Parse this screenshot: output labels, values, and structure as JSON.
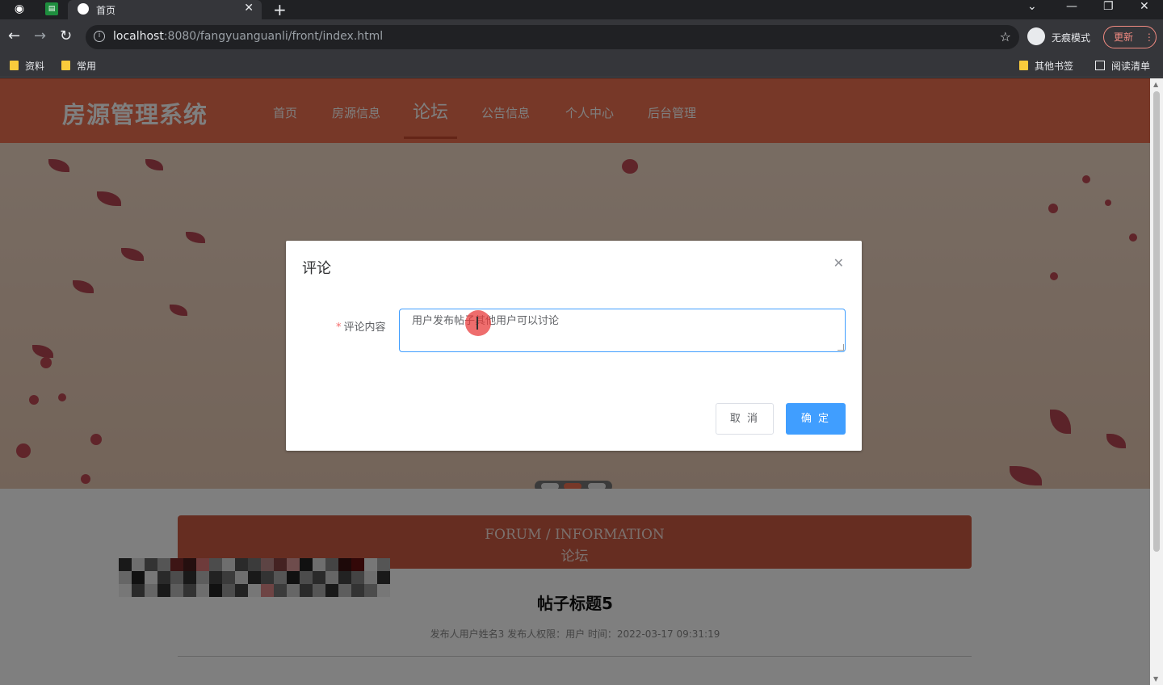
{
  "browser": {
    "tab_title": "首页",
    "url_host": "localhost",
    "url_rest": ":8080/fangyuanguanli/front/index.html",
    "incognito_label": "无痕模式",
    "update_label": "更新",
    "bookmarks": [
      "资料",
      "常用"
    ],
    "bookmarks_right": [
      "其他书签",
      "阅读清单"
    ]
  },
  "site": {
    "logo": "房源管理系统",
    "menu": [
      "首页",
      "房源信息",
      "论坛",
      "公告信息",
      "个人中心",
      "后台管理"
    ],
    "active_menu": "论坛",
    "accent_color": "#ee7050"
  },
  "section": {
    "heading_en": "FORUM / INFORMATION",
    "heading_cn": "论坛",
    "post_title": "帖子标题5",
    "post_meta": "发布人用户姓名3   发布人权限：用户   时间：2022-03-17 09:31:19"
  },
  "dialog": {
    "title": "评论",
    "field_label": "评论内容",
    "field_value": "用户发布帖子其他用户可以讨论",
    "cancel_label": "取 消",
    "ok_label": "确 定",
    "primary_color": "#409eff"
  }
}
